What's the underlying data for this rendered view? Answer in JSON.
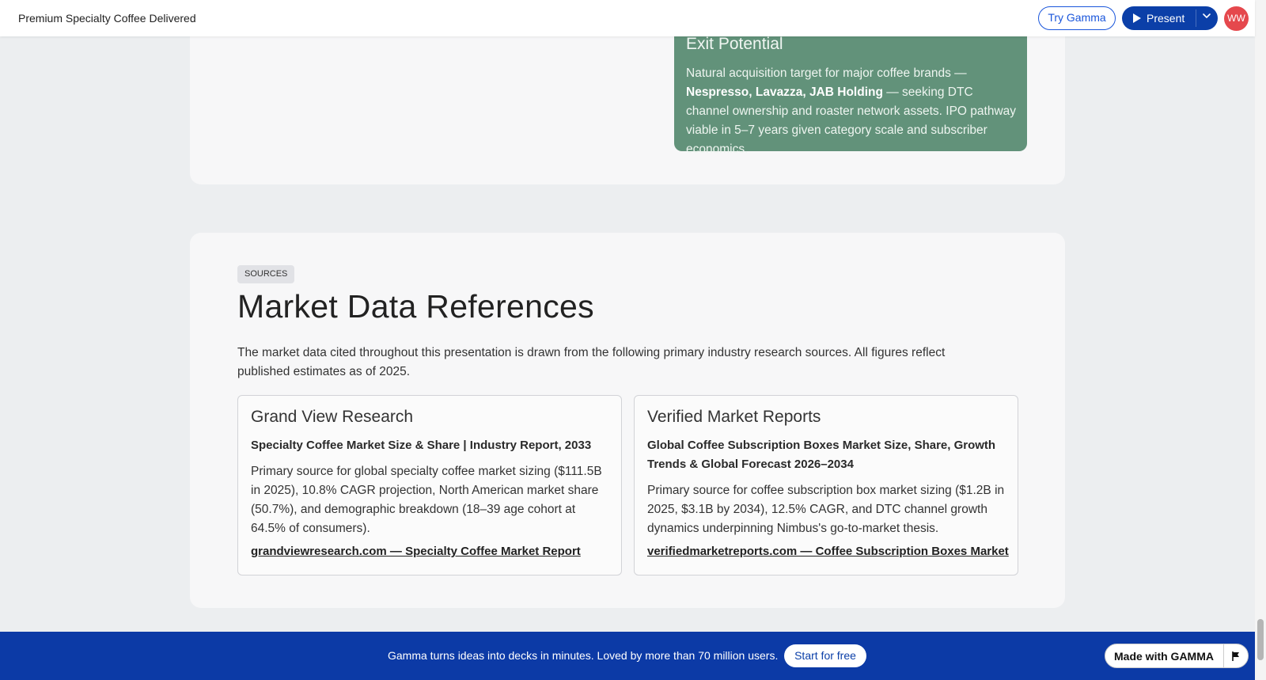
{
  "topbar": {
    "doc_title": "Premium Specialty Coffee Delivered",
    "try_label": "Try Gamma",
    "present_label": "Present",
    "avatar_initials": "WW"
  },
  "exit": {
    "title": "Exit Potential",
    "text_pre": "Natural acquisition target for major coffee brands — ",
    "text_bold": "Nespresso, Lavazza, JAB Holding",
    "text_post": " — seeking DTC channel ownership and roaster network assets. IPO pathway viable in 5–7 years given category scale and subscriber economics."
  },
  "sources": {
    "tag": "SOURCES",
    "heading": "Market Data References",
    "intro": "The market data cited throughout this presentation is drawn from the following primary industry research sources. All figures reflect published estimates as of 2025.",
    "refs": [
      {
        "title": "Grand View Research",
        "subtitle": "Specialty Coffee Market Size & Share | Industry Report, 2033",
        "description": "Primary source for global specialty coffee market sizing ($111.5B in 2025), 10.8% CAGR projection, North American market share (50.7%), and demographic breakdown (18–39 age cohort at 64.5% of consumers).",
        "link": "grandviewresearch.com — Specialty Coffee Market Report"
      },
      {
        "title": "Verified Market Reports",
        "subtitle": "Global Coffee Subscription Boxes Market Size, Share, Growth Trends & Global Forecast 2026–2034",
        "description": "Primary source for coffee subscription box market sizing ($1.2B in 2025, $3.1B by 2034), 12.5% CAGR, and DTC channel growth dynamics underpinning Nimbus's go-to-market thesis.",
        "link": "verifiedmarketreports.com — Coffee Subscription Boxes Market"
      }
    ]
  },
  "banner": {
    "text": "Gamma turns ideas into decks in minutes. Loved by more than 70 million users.",
    "cta": "Start for free",
    "made_with": "Made with GAMMA"
  },
  "colors": {
    "accent": "#0b3fa8",
    "exit_box": "#62927a",
    "avatar": "#e5484d"
  }
}
